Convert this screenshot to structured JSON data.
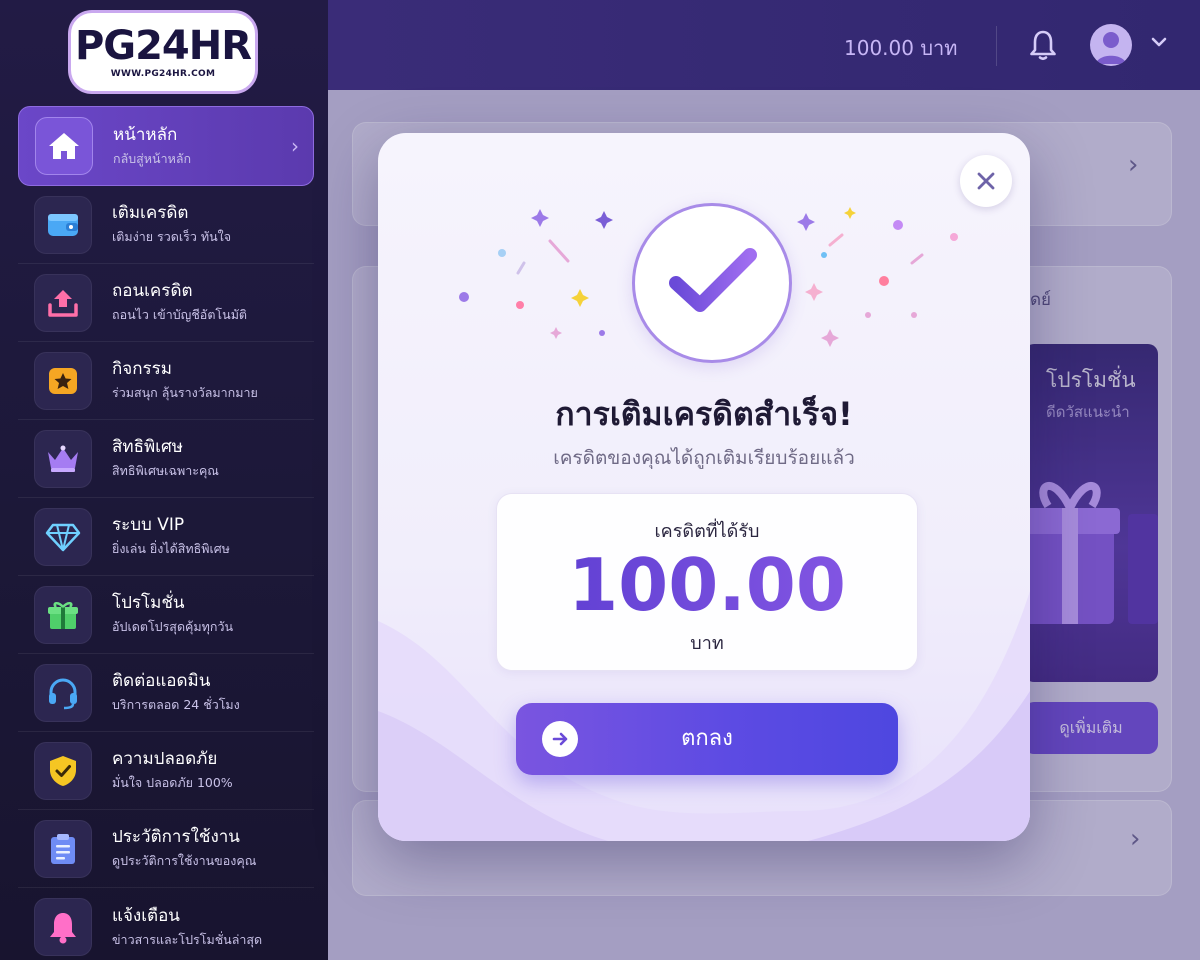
{
  "brand": {
    "logo_text_a": "PG",
    "logo_text_b": "24",
    "logo_text_c": "HR",
    "logo_url": "WWW.PG24HR.COM"
  },
  "sidebar": {
    "items": [
      {
        "title": "หน้าหลัก",
        "subtitle": "กลับสู่หน้าหลัก",
        "icon": "home-icon",
        "active": true
      },
      {
        "title": "เติมเครดิต",
        "subtitle": "เติมง่าย รวดเร็ว ทันใจ",
        "icon": "wallet-icon"
      },
      {
        "title": "ถอนเครดิต",
        "subtitle": "ถอนไว เข้าบัญชีอัตโนมัติ",
        "icon": "upload-icon"
      },
      {
        "title": "กิจกรรม",
        "subtitle": "ร่วมสนุก ลุ้นรางวัลมากมาย",
        "icon": "star-icon"
      },
      {
        "title": "สิทธิพิเศษ",
        "subtitle": "สิทธิพิเศษเฉพาะคุณ",
        "icon": "crown-icon"
      },
      {
        "title": "ระบบ VIP",
        "subtitle": "ยิ่งเล่น ยิ่งได้สิทธิพิเศษ",
        "icon": "diamond-icon"
      },
      {
        "title": "โปรโมชั่น",
        "subtitle": "อัปเดตโปรสุดคุ้มทุกวัน",
        "icon": "gift-icon"
      },
      {
        "title": "ติดต่อแอดมิน",
        "subtitle": "บริการตลอด 24 ชั่วโมง",
        "icon": "headset-icon"
      },
      {
        "title": "ความปลอดภัย",
        "subtitle": "มั่นใจ ปลอดภัย 100%",
        "icon": "shield-icon"
      },
      {
        "title": "ประวัติการใช้งาน",
        "subtitle": "ดูประวัติการใช้งานของคุณ",
        "icon": "clipboard-icon"
      },
      {
        "title": "แจ้งเตือน",
        "subtitle": "ข่าวสารและโปรโมชั่นล่าสุด",
        "icon": "bell-icon"
      }
    ]
  },
  "topbar": {
    "balance": "100.00 บาท",
    "icons": [
      "bell-icon",
      "avatar-icon",
      "chevron-down-icon"
    ]
  },
  "background": {
    "promo_title": "โปรโมชั่น",
    "promo_subtitle": "ดีดวัสแนะนำ",
    "promo_button": "ดูเพิ่มเติม",
    "section_label": "ดย์"
  },
  "modal": {
    "title": "การเติมเครดิตสำเร็จ!",
    "subtitle": "เครดิตของคุณได้ถูกเติมเรียบร้อยแล้ว",
    "credit_label": "เครดิตที่ได้รับ",
    "credit_amount": "100.00",
    "credit_unit": "บาท",
    "ok_label": "ตกลง"
  },
  "colors": {
    "accent": "#6a4ad8",
    "sidebar_bg": "#1c1838",
    "active_item": "#6b47c8",
    "topbar_bg": "#3a2c78"
  }
}
